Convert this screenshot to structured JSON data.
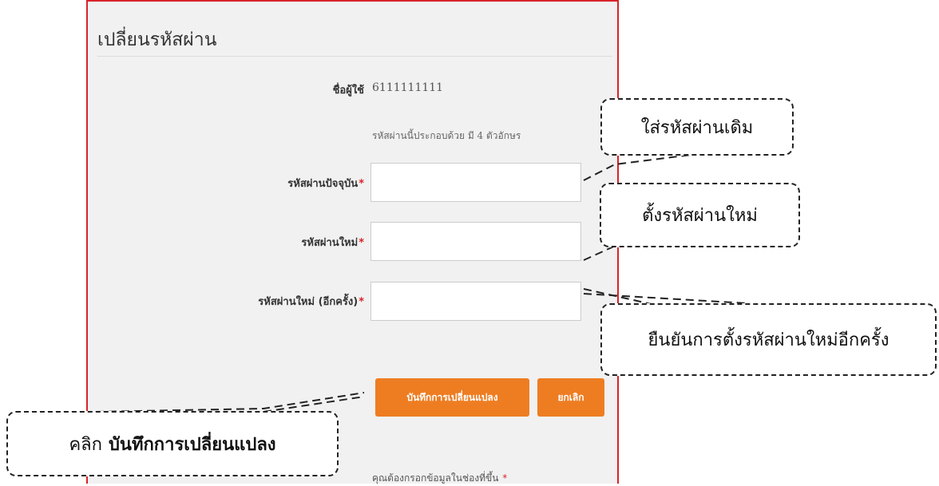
{
  "form": {
    "title": "เปลี่ยนรหัสผ่าน",
    "username_label": "ชื่อผู้ใช้",
    "username_value": "6111111111",
    "password_hint": "รหัสผ่านนี้ประกอบด้วย มี 4 ตัวอักษร",
    "current_password_label": "รหัสผ่านปัจจุบัน",
    "new_password_label": "รหัสผ่านใหม่",
    "confirm_password_label": "รหัสผ่านใหม่ (อีกครั้ง)",
    "required_marker": "*",
    "current_password_value": "",
    "new_password_value": "",
    "confirm_password_value": "",
    "save_button": "บันทึกการเปลี่ยนแปลง",
    "cancel_button": "ยกเลิก",
    "required_note": "คุณต้องกรอกข้อมูลในช่องที่ขึ้น"
  },
  "annotations": {
    "current_password": "ใส่รหัสผ่านเดิม",
    "new_password": "ตั้งรหัสผ่านใหม่",
    "confirm_password": "ยืนยันการตั้งรหัสผ่านใหม่อีกครั้ง",
    "click_prefix": "คลิก",
    "click_target": "บันทึกการเปลี่ยนแปลง"
  },
  "colors": {
    "panel_border": "#d9232a",
    "panel_background": "#f1f1f1",
    "button": "#ee7d22",
    "required": "#d9232a"
  }
}
